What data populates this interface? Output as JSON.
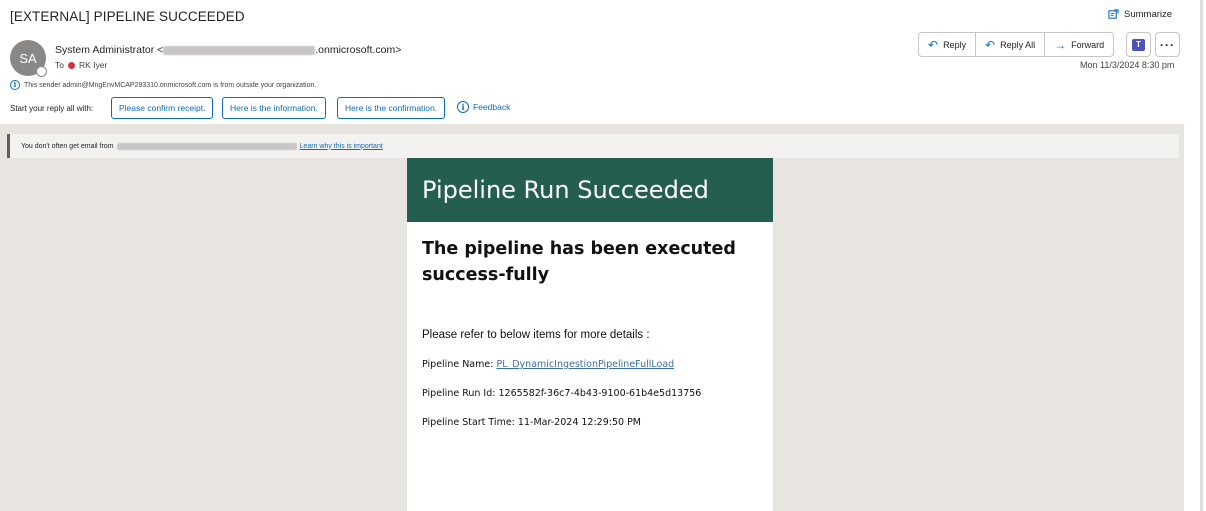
{
  "email": {
    "subject": "[EXTERNAL] PIPELINE SUCCEEDED",
    "summarize_label": "Summarize",
    "avatar_initials": "SA",
    "sender_name": "System Administrator <",
    "sender_domain_suffix": ".onmicrosoft.com>",
    "to_label": "To",
    "recipient": "RK Iyer",
    "outside_notice": "This sender admin@MngEnvMCAP293310.onmicrosoft.com is from outside your organization.",
    "date": "Mon 11/3/2024 8:30 pm"
  },
  "actions": {
    "reply": "Reply",
    "reply_all": "Reply All",
    "forward": "Forward",
    "more": "···"
  },
  "quick_replies": {
    "prompt": "Start your reply all with:",
    "options": [
      "Please confirm receipt.",
      "Here is the information.",
      "Here is the confirmation."
    ],
    "feedback": "Feedback"
  },
  "safety_banner": {
    "text": "You don't often get email from",
    "link": "Learn why this is important"
  },
  "message": {
    "header": "Pipeline Run Succeeded",
    "title": "The pipeline has been executed success-fully",
    "intro": "Please refer to below items for more details :",
    "pipeline_name_label": "Pipeline Name:",
    "pipeline_name": "PL_DynamicIngestionPipelineFullLoad",
    "run_id_label": "Pipeline Run Id:",
    "run_id": "1265582f-36c7-4b43-9100-61b4e5d13756",
    "start_time_label": "Pipeline Start Time:",
    "start_time": "11-Mar-2024 12:29:50 PM"
  },
  "colors": {
    "accent": "#0f6cbd",
    "card_header": "#235e4f",
    "body_bg": "#e8e5e0"
  }
}
